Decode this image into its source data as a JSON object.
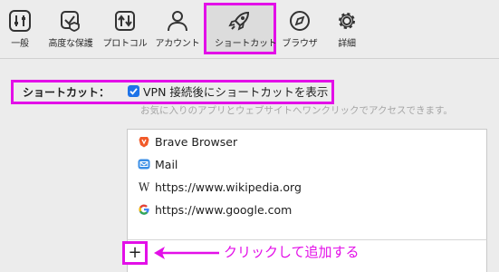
{
  "toolbar": {
    "items": [
      {
        "label": "一般",
        "icon": "sliders-icon"
      },
      {
        "label": "高度な保護",
        "icon": "shield-check-icon"
      },
      {
        "label": "プロトコル",
        "icon": "protocol-arrows-icon"
      },
      {
        "label": "アカウント",
        "icon": "person-icon"
      },
      {
        "label": "ショートカット",
        "icon": "rocket-icon",
        "selected": true
      },
      {
        "label": "ブラウザ",
        "icon": "compass-icon"
      },
      {
        "label": "詳細",
        "icon": "gear-icon"
      }
    ]
  },
  "shortcut": {
    "label": "ショートカット：",
    "checkbox_label": "VPN 接続後にショートカットを表示",
    "checked": true,
    "help": "お気に入りのアプリとウェブサイトへワンクリックでアクセスできます。"
  },
  "list": {
    "items": [
      {
        "label": "Brave Browser",
        "icon": "brave-icon"
      },
      {
        "label": "Mail",
        "icon": "mail-icon"
      },
      {
        "label": "https://www.wikipedia.org",
        "icon": "wikipedia-icon"
      },
      {
        "label": "https://www.google.com",
        "icon": "google-icon"
      }
    ]
  },
  "add_button": {
    "label": "+"
  },
  "annotation": {
    "text": "クリックして追加する"
  },
  "colors": {
    "highlight": "#e30fe8",
    "accent": "#1e73e8"
  }
}
